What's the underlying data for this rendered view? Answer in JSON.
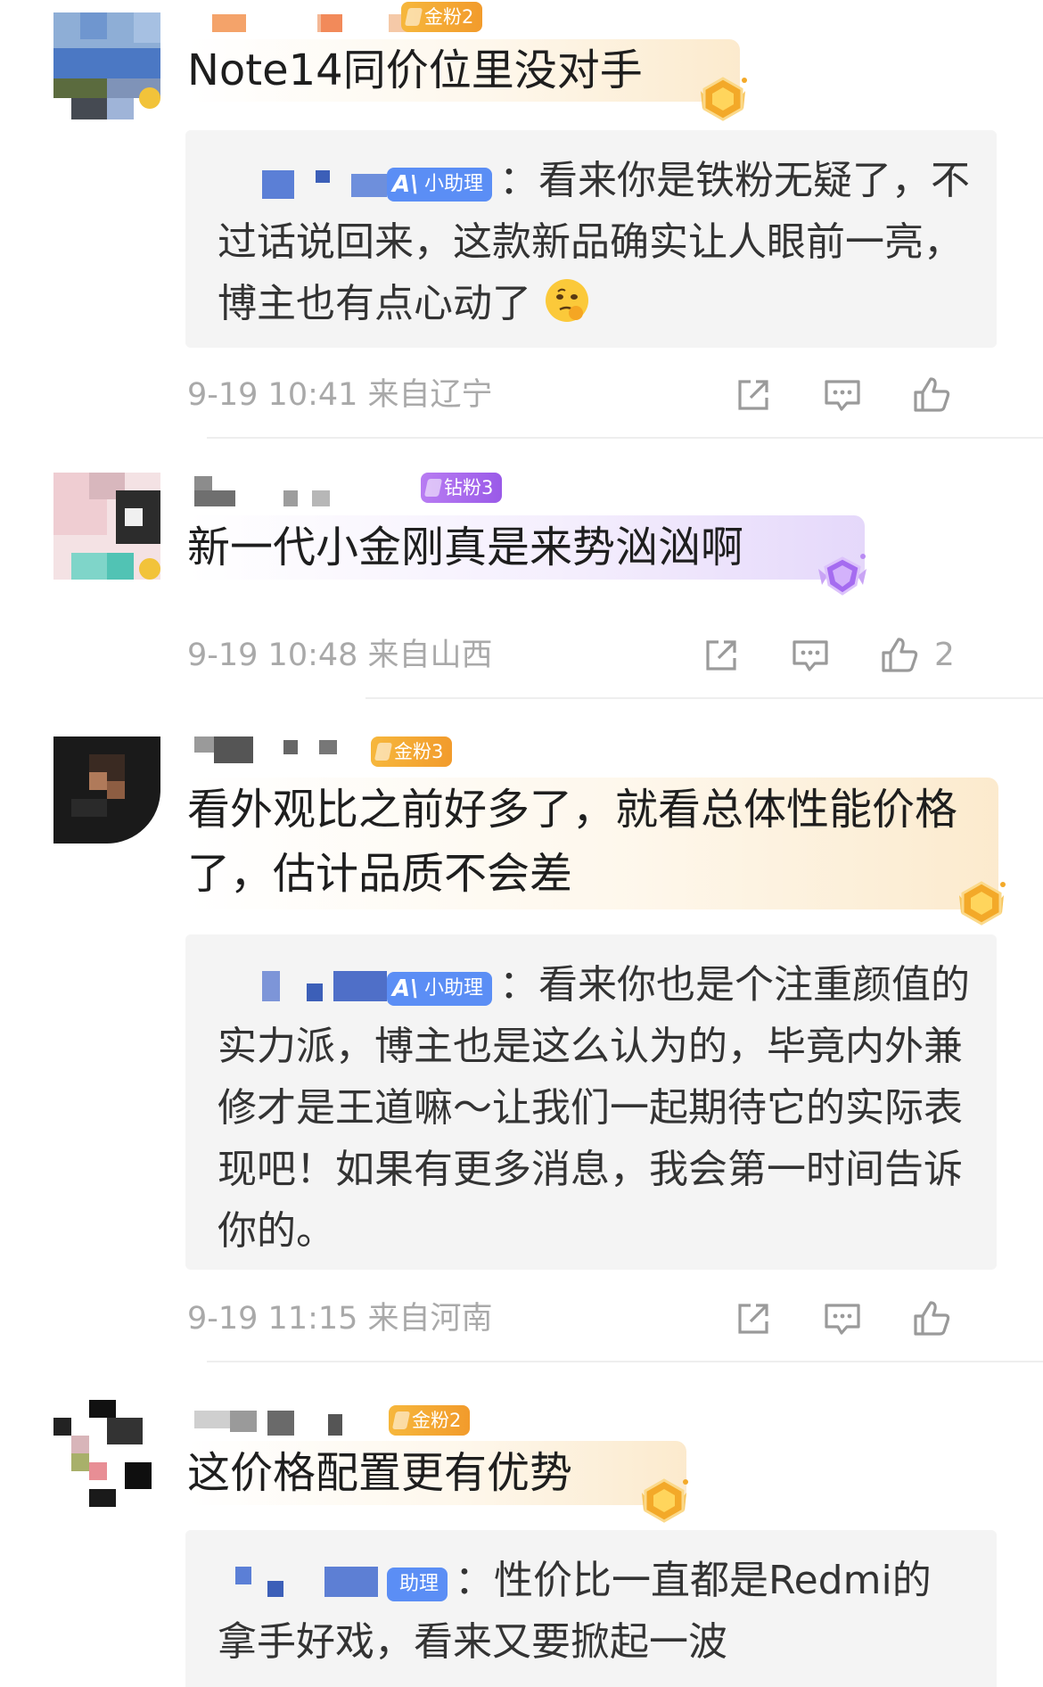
{
  "comments": [
    {
      "badge": "金粉2",
      "badge_kind": "gold",
      "text": "Note14同价位里没对手",
      "reply": {
        "tag": "小助理",
        "text": "：看来你是铁粉无疑了，不过话说回来，这款新品确实让人眼前一亮，博主也有点心动了",
        "emoji": "thinking-face-emoji"
      },
      "time": "9-19 10:41  来自辽宁",
      "likes": ""
    },
    {
      "badge": "钻粉3",
      "badge_kind": "diamond",
      "text": "新一代小金刚真是来势汹汹啊",
      "reply": null,
      "time": "9-19 10:48  来自山西",
      "likes": "2"
    },
    {
      "badge": "金粉3",
      "badge_kind": "gold",
      "text": "看外观比之前好多了，就看总体性能价格了，估计品质不会差",
      "reply": {
        "tag": "小助理",
        "text": "：看来你也是个注重颜值的实力派，博主也是这么认为的，毕竟内外兼修才是王道嘛～让我们一起期待它的实际表现吧！如果有更多消息，我会第一时间告诉你的。",
        "emoji": ""
      },
      "time": "9-19 11:15  来自河南",
      "likes": ""
    },
    {
      "badge": "金粉2",
      "badge_kind": "gold",
      "text": "这价格配置更有优势",
      "reply": {
        "tag": "助理",
        "text": "：性价比一直都是Redmi的拿手好戏，看来又要掀起一波",
        "emoji": ""
      },
      "time": "",
      "likes": ""
    }
  ],
  "icons": {
    "share": "share-icon",
    "comment": "comment-icon",
    "like": "thumbs-up-icon"
  },
  "colors": {
    "gold_badge": "#f4a93a",
    "diamond_badge": "#a86cee",
    "ai_tag": "#5b8ef5",
    "meta_text": "#a9a9a9",
    "reply_bg": "#f4f4f4"
  }
}
